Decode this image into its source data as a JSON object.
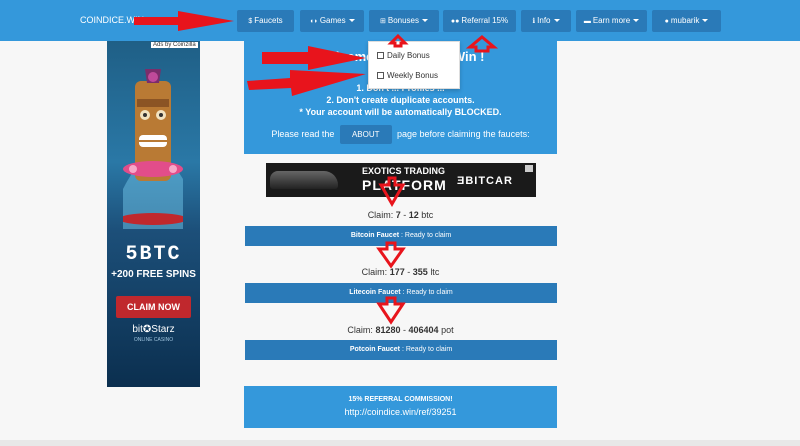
{
  "nav": {
    "brand": "COINDICE.WIN",
    "items": [
      {
        "label": "Faucets",
        "icon": "dollar-icon",
        "glyph": "$",
        "dropdown": false
      },
      {
        "label": "Games",
        "icon": "gamepad-icon",
        "glyph": "◖◗",
        "dropdown": true
      },
      {
        "label": "Bonuses",
        "icon": "plus-square-icon",
        "glyph": "⊞",
        "dropdown": true
      },
      {
        "label": "Referral 15%",
        "icon": "users-icon",
        "glyph": "●●",
        "dropdown": false
      },
      {
        "label": "Info",
        "icon": "info-icon",
        "glyph": "ℹ",
        "dropdown": true
      },
      {
        "label": "Earn more",
        "icon": "money-icon",
        "glyph": "▬",
        "dropdown": true
      },
      {
        "label": "mubarik",
        "icon": "user-icon",
        "glyph": "●",
        "dropdown": true
      }
    ]
  },
  "bonuses_menu": {
    "items": [
      "Daily Bonus",
      "Weekly Bonus"
    ]
  },
  "ad": {
    "label": "Ads by Coinzilla",
    "headline": "5BTC",
    "subline": "+200 FREE SPINS",
    "cta": "CLAIM NOW",
    "brand": "bit✪Starz",
    "brand_sub": "ONLINE CASINO"
  },
  "hero": {
    "title": "Welcome to CoinDice.Win !",
    "line1": "R",
    "line2": "1. Don't ... Profiles ... ",
    "line3": "2. Don't create duplicate accounts.",
    "line4": "* Your account will be automatically BLOCKED.",
    "read_before": "Please read the",
    "about_button": "ABOUT",
    "read_after": "page before claiming the faucets:"
  },
  "banner": {
    "line1": "EXOTICS TRADING",
    "line2": "PLATFORM",
    "logo": "ƎBITCAR"
  },
  "faucets": [
    {
      "claim_prefix": "Claim:",
      "min": "7",
      "sep": "-",
      "max": "12",
      "unit": "btc",
      "name": "Bitcoin Faucet",
      "status": ": Ready to claim"
    },
    {
      "claim_prefix": "Claim:",
      "min": "177",
      "sep": "-",
      "max": "355",
      "unit": "ltc",
      "name": "Litecoin Faucet",
      "status": ": Ready to claim"
    },
    {
      "claim_prefix": "Claim:",
      "min": "81280",
      "sep": "-",
      "max": "406404",
      "unit": "pot",
      "name": "Potcoin Faucet",
      "status": ": Ready to claim"
    }
  ],
  "referral": {
    "title": "15% REFERRAL COMMISSION!",
    "url": "http://coindice.win/ref/39251"
  },
  "colors": {
    "primary": "#3498db",
    "button": "#2a7ab8",
    "annotation": "#e8141c"
  }
}
